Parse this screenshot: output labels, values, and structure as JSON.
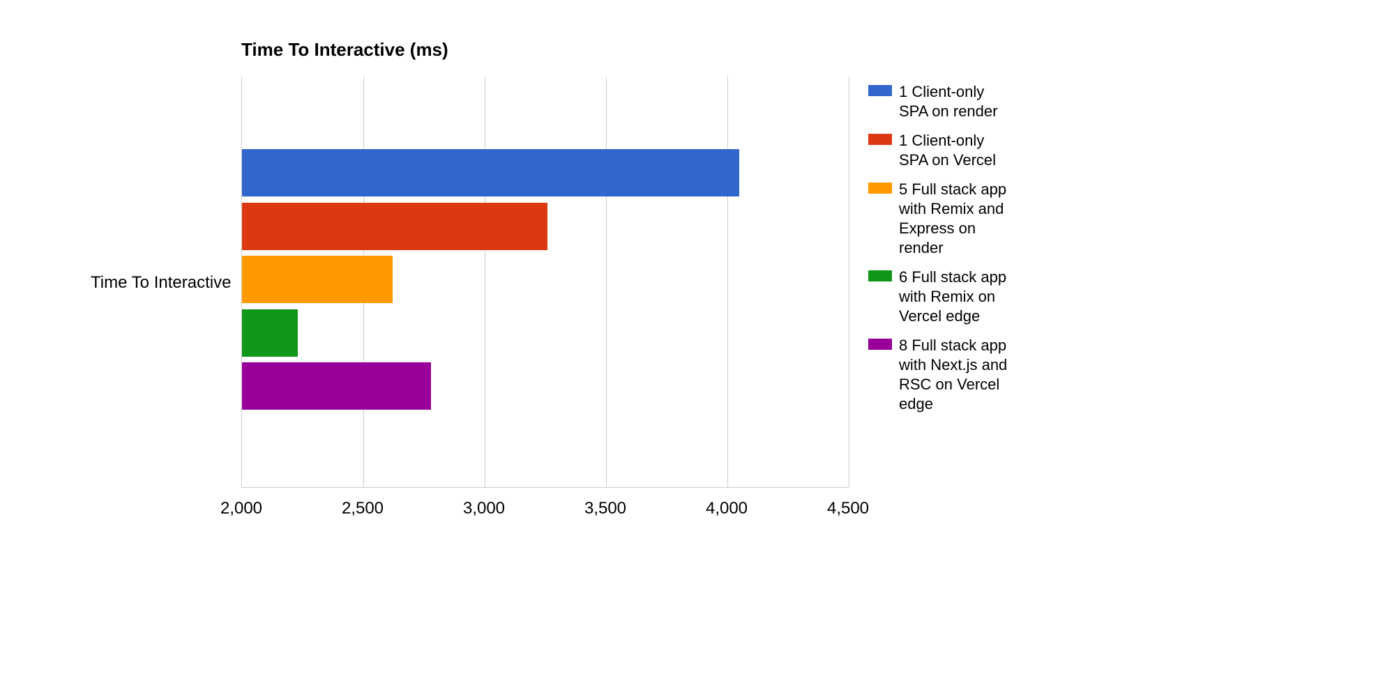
{
  "chart_data": {
    "type": "bar",
    "orientation": "horizontal",
    "title": "Time To Interactive (ms)",
    "categories": [
      "Time To Interactive"
    ],
    "series": [
      {
        "name": "1 Client-only SPA on render",
        "values": [
          4050
        ],
        "color": "#3366cc"
      },
      {
        "name": "1 Client-only SPA on Vercel",
        "values": [
          3260
        ],
        "color": "#dc3912"
      },
      {
        "name": "5 Full stack app with Remix and Express on render",
        "values": [
          2620
        ],
        "color": "#ff9900"
      },
      {
        "name": "6 Full stack app with Remix on Vercel edge",
        "values": [
          2230
        ],
        "color": "#109618"
      },
      {
        "name": "8 Full stack app with Next.js and RSC on Vercel edge",
        "values": [
          2780
        ],
        "color": "#990099"
      }
    ],
    "xlabel": "",
    "ylabel": "",
    "xlim": [
      2000,
      4500
    ],
    "x_ticks": [
      2000,
      2500,
      3000,
      3500,
      4000,
      4500
    ],
    "x_tick_labels": [
      "2,000",
      "2,500",
      "3,000",
      "3,500",
      "4,000",
      "4,500"
    ],
    "grid": true,
    "legend_position": "right"
  }
}
